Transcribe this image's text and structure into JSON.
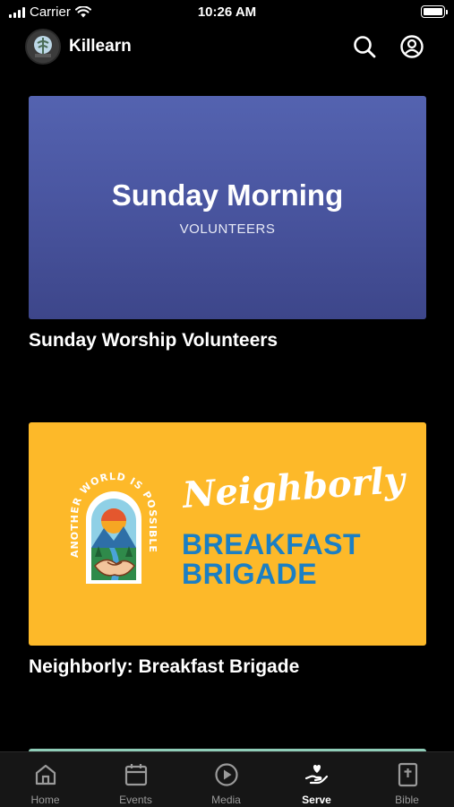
{
  "status_bar": {
    "carrier": "Carrier",
    "time": "10:26 AM"
  },
  "header": {
    "app_name": "Killearn",
    "icons": [
      "search-icon",
      "account-icon"
    ]
  },
  "cards": [
    {
      "title": "Sunday Worship Volunteers",
      "image_headline": "Sunday Morning",
      "image_subline": "VOLUNTEERS"
    },
    {
      "title": "Neighborly: Breakfast Brigade",
      "image_script": "Neighborly",
      "image_line1": "BREAKFAST",
      "image_line2": "BRIGADE",
      "image_badge_text": "ANOTHER WORLD IS POSSIBLE"
    }
  ],
  "tabs": [
    {
      "label": "Home",
      "icon": "home-icon"
    },
    {
      "label": "Events",
      "icon": "calendar-icon"
    },
    {
      "label": "Media",
      "icon": "play-icon"
    },
    {
      "label": "Serve",
      "icon": "serve-hand-icon"
    },
    {
      "label": "Bible",
      "icon": "bible-icon"
    }
  ],
  "active_tab": "Serve",
  "colors": {
    "background": "#000000",
    "tab_bar": "#161616",
    "sunday_card": "#4a56a1",
    "breakfast_card": "#fdb929",
    "breakfast_blue": "#1b7fc4",
    "inactive_tab": "#9a9a9a"
  }
}
